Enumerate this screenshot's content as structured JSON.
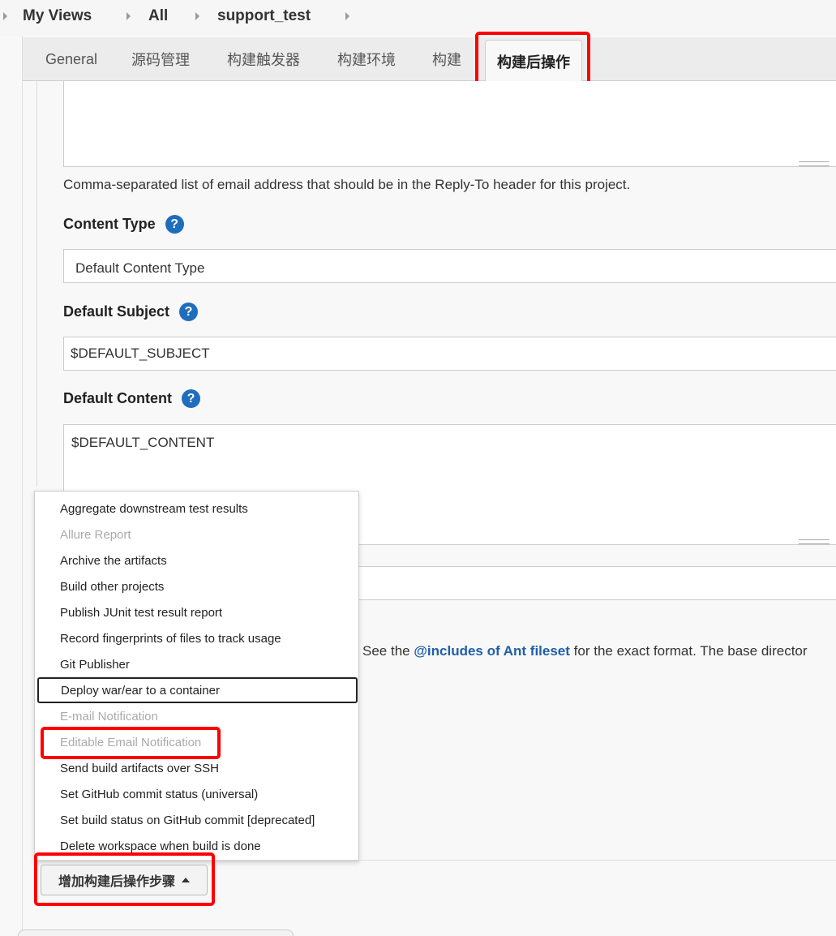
{
  "breadcrumb": {
    "items": [
      "My Views",
      "All",
      "support_test"
    ]
  },
  "tabs": [
    "General",
    "源码管理",
    "构建触发器",
    "构建环境",
    "构建",
    "构建后操作"
  ],
  "active_tab": "构建后操作",
  "reply_to": {
    "help": "Comma-separated list of email address that should be in the Reply-To header for this project."
  },
  "content_type": {
    "label": "Content Type",
    "value": "Default Content Type"
  },
  "default_subject": {
    "label": "Default Subject",
    "value": "$DEFAULT_SUBJECT"
  },
  "default_content": {
    "label": "Default Content",
    "value": "$DEFAULT_CONTENT"
  },
  "attachments": {
    "help_prefix": "See the",
    "help_link": "@includes of Ant fileset",
    "help_suffix": "for the exact format. The base director"
  },
  "help_icon_glyph": "?",
  "dropdown": {
    "items": [
      {
        "label": "Aggregate downstream test results",
        "disabled": false
      },
      {
        "label": "Allure Report",
        "disabled": true
      },
      {
        "label": "Archive the artifacts",
        "disabled": false
      },
      {
        "label": "Build other projects",
        "disabled": false
      },
      {
        "label": "Publish JUnit test result report",
        "disabled": false
      },
      {
        "label": "Record fingerprints of files to track usage",
        "disabled": false
      },
      {
        "label": "Git Publisher",
        "disabled": false
      },
      {
        "label": "Deploy war/ear to a container",
        "disabled": false,
        "focused": true
      },
      {
        "label": "E-mail Notification",
        "disabled": true
      },
      {
        "label": "Editable Email Notification",
        "disabled": true
      },
      {
        "label": "Send build artifacts over SSH",
        "disabled": false
      },
      {
        "label": "Set GitHub commit status (universal)",
        "disabled": false
      },
      {
        "label": "Set build status on GitHub commit [deprecated]",
        "disabled": false
      },
      {
        "label": "Delete workspace when build is done",
        "disabled": false
      }
    ]
  },
  "add_button": {
    "label": "增加构建后操作步骤"
  },
  "colors": {
    "highlight": "#ff0000",
    "help_icon": "#1f6dbd",
    "link": "#1f5fa8"
  }
}
